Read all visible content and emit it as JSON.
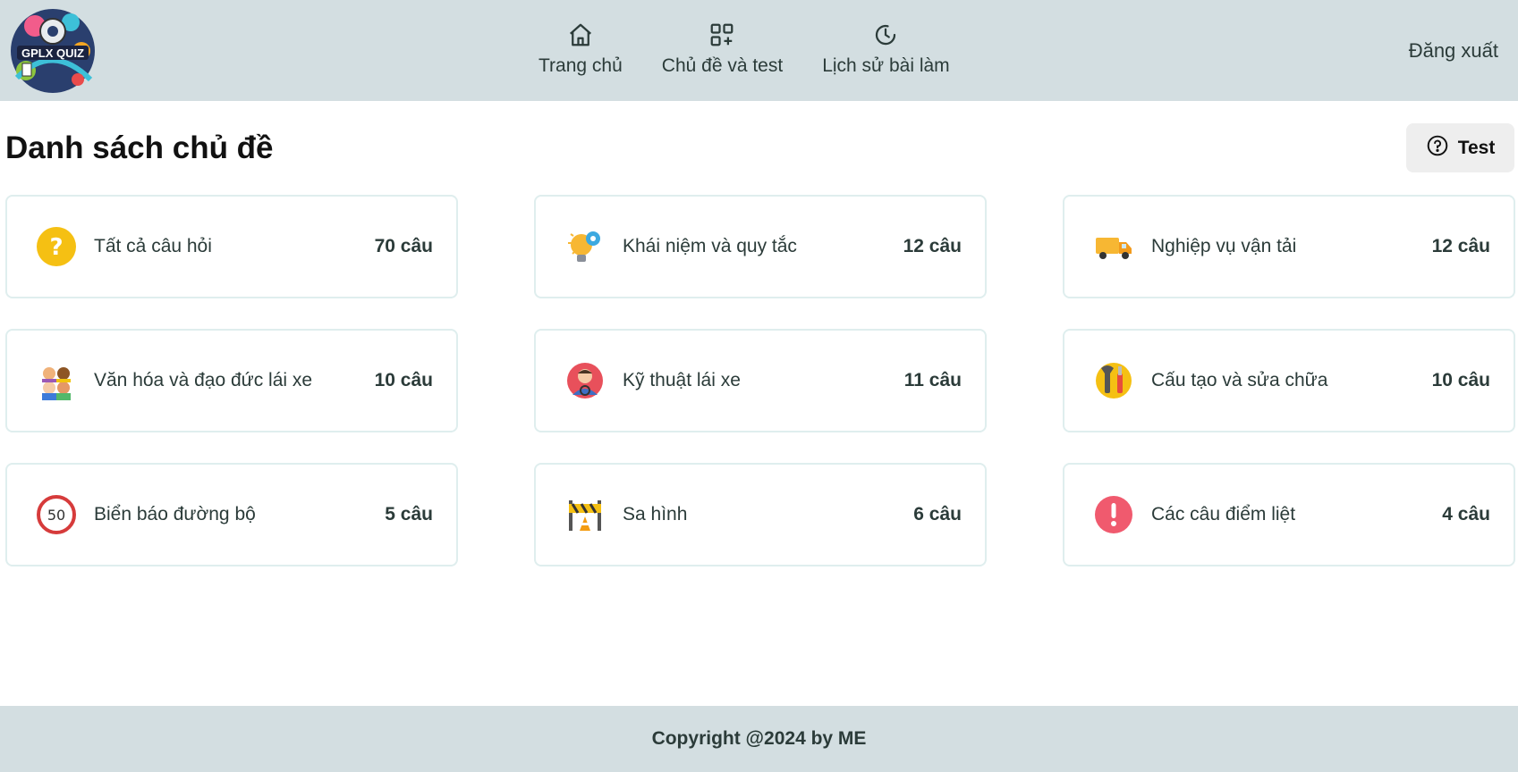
{
  "header": {
    "logo_text": "GPLX QUIZ",
    "nav": [
      {
        "label": "Trang chủ",
        "icon": "home-icon"
      },
      {
        "label": "Chủ đề và test",
        "icon": "grid-plus-icon"
      },
      {
        "label": "Lịch sử bài làm",
        "icon": "history-icon"
      }
    ],
    "logout_label": "Đăng xuất"
  },
  "main": {
    "title": "Danh sách chủ đề",
    "test_button_label": "Test",
    "topics": [
      {
        "name": "Tất cả câu hỏi",
        "count": "70 câu",
        "icon": "question-icon"
      },
      {
        "name": "Khái niệm và quy tắc",
        "count": "12 câu",
        "icon": "lightbulb-gear-icon"
      },
      {
        "name": "Nghiệp vụ vận tải",
        "count": "12 câu",
        "icon": "truck-icon"
      },
      {
        "name": "Văn hóa và đạo đức lái xe",
        "count": "10 câu",
        "icon": "people-icon"
      },
      {
        "name": "Kỹ thuật lái xe",
        "count": "11 câu",
        "icon": "driver-icon"
      },
      {
        "name": "Cấu tạo và sửa chữa",
        "count": "10 câu",
        "icon": "tools-icon"
      },
      {
        "name": "Biển báo đường bộ",
        "count": "5 câu",
        "icon": "speed-sign-icon"
      },
      {
        "name": "Sa hình",
        "count": "6 câu",
        "icon": "road-barrier-icon"
      },
      {
        "name": "Các câu điểm liệt",
        "count": "4 câu",
        "icon": "alert-icon"
      }
    ]
  },
  "footer": {
    "copyright": "Copyright @2024 by ME"
  },
  "colors": {
    "header_bg": "#d3dee1",
    "card_border": "#dfeeee",
    "question_yellow": "#f5c013",
    "alert_red": "#f05a6e"
  }
}
